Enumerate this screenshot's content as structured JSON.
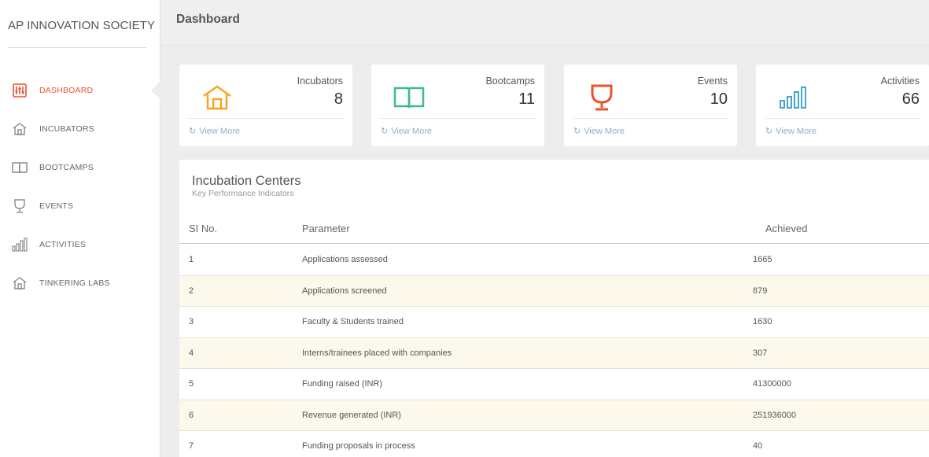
{
  "brand": "AP INNOVATION SOCIETY",
  "sidebar": {
    "items": [
      {
        "label": "DASHBOARD",
        "icon": "dashboard-icon",
        "active": true
      },
      {
        "label": "INCUBATORS",
        "icon": "home-icon"
      },
      {
        "label": "BOOTCAMPS",
        "icon": "book-icon"
      },
      {
        "label": "EVENTS",
        "icon": "trophy-icon"
      },
      {
        "label": "ACTIVITIES",
        "icon": "bar-chart-icon"
      },
      {
        "label": "TINKERING LABS",
        "icon": "home-icon"
      }
    ]
  },
  "header": {
    "title": "Dashboard"
  },
  "cards": [
    {
      "title": "Incubators",
      "value": "8",
      "icon": "home-icon",
      "color": "#f5a623",
      "link": "View More"
    },
    {
      "title": "Bootcamps",
      "value": "11",
      "icon": "book-icon",
      "color": "#3cbc8d",
      "link": "View More"
    },
    {
      "title": "Events",
      "value": "10",
      "icon": "trophy-icon",
      "color": "#e8542d",
      "link": "View More"
    },
    {
      "title": "Activities",
      "value": "66",
      "icon": "bar-chart-icon",
      "color": "#4aa3c8",
      "link": "View More"
    }
  ],
  "panel": {
    "title": "Incubation Centers",
    "subtitle": "Key Performance Indicators",
    "columns": [
      "SI No.",
      "Parameter",
      "Achieved"
    ],
    "rows": [
      [
        "1",
        "Applications assessed",
        "1665"
      ],
      [
        "2",
        "Applications screened",
        "879"
      ],
      [
        "3",
        "Faculty & Students trained",
        "1630"
      ],
      [
        "4",
        "Interns/trainees placed with companies",
        "307"
      ],
      [
        "5",
        "Funding raised (INR)",
        "41300000"
      ],
      [
        "6",
        "Revenue generated (INR)",
        "251936000"
      ],
      [
        "7",
        "Funding proposals in process",
        "40"
      ]
    ]
  },
  "colors": {
    "accent": "#e8542d",
    "link": "#8fb0c8",
    "row_alt": "#fdf8ec"
  }
}
